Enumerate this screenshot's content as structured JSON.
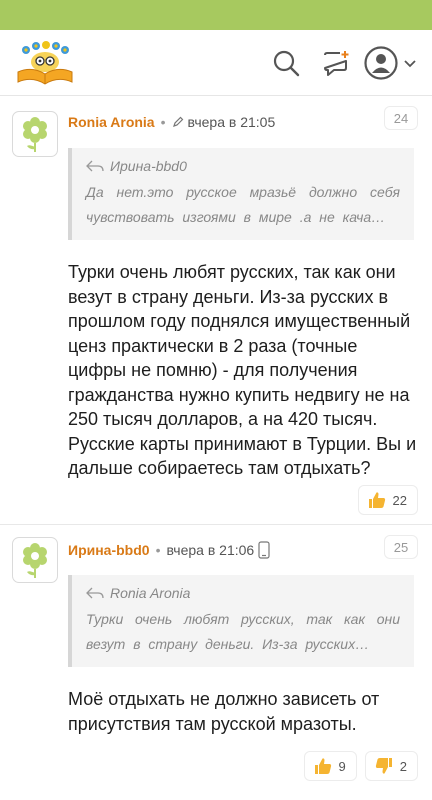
{
  "header": {
    "colors": {
      "strip": "#a7c95f",
      "logo_book": "#f4a623",
      "logo_flowers": "#3f9ad8"
    },
    "icons": [
      "search-icon",
      "add-comment-icon",
      "profile-icon",
      "chevron-down-icon"
    ]
  },
  "comments": [
    {
      "author": "Ronia Aronia",
      "dot": "•",
      "time": "вчера в 21:05",
      "number": "24",
      "quote_author": "Ирина-bbd0",
      "quote_text": "Да нет.это русское мразьё должно себя чувствовать изгоями в мире .а не кача…",
      "text": "Турки очень любят русских, так как они везут в страну деньги. Из-за русских в прошлом году поднялся имущественный ценз практически в 2 раза (точные цифры не помню) - для получения гражданства нужно купить недвигу не на 250 тысяч долларов, а на 420 тысяч. Русские карты принимают в Турции. Вы и дальше собираетесь там отдыхать?",
      "likes": "22"
    },
    {
      "author": "Ирина-bbd0",
      "dot": "•",
      "time": "вчера в 21:06",
      "number": "25",
      "quote_author": "Ronia Aronia",
      "quote_text": "Турки очень любят русских, так как они везут в страну деньги. Из-за русских…",
      "text": "Моё отдыхать не должно зависеть от присутствия там русской мразоты.",
      "likes": "9",
      "dislikes": "2"
    }
  ]
}
